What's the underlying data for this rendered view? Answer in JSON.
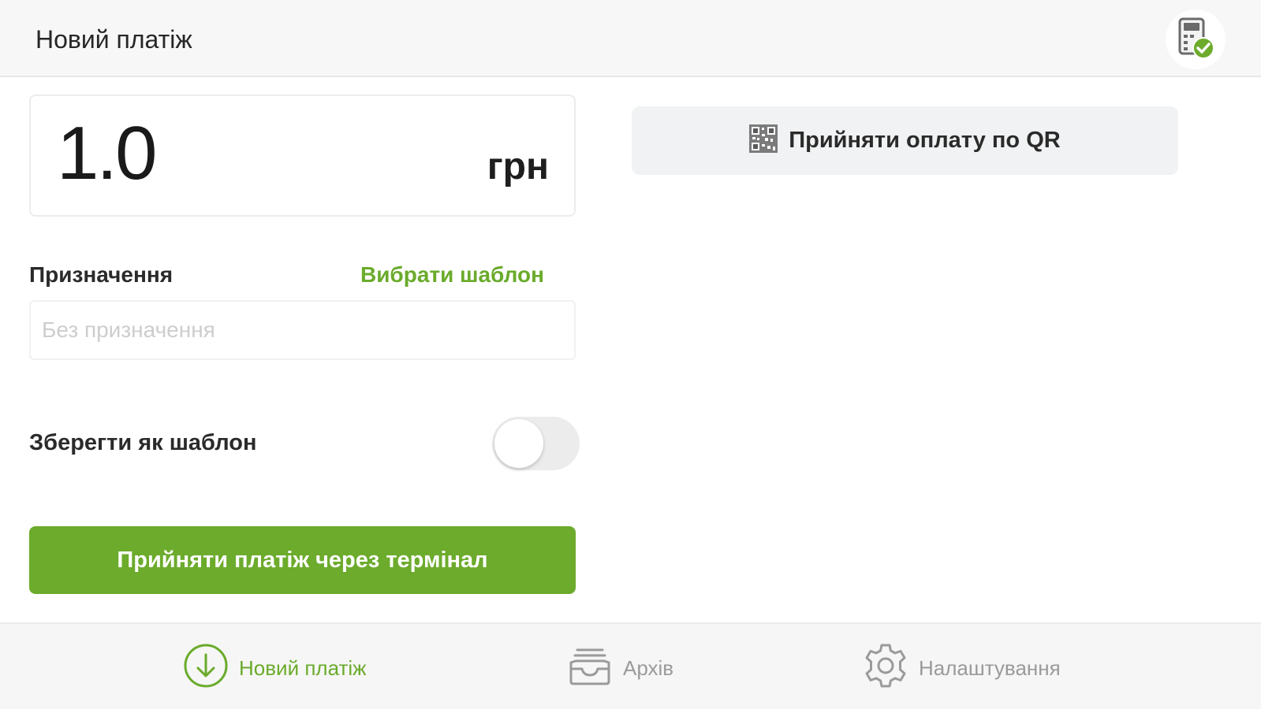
{
  "header": {
    "title": "Новий платіж",
    "terminal_icon": "terminal-connected-icon"
  },
  "amount": {
    "value": "1.0",
    "currency": "грн"
  },
  "qr_button": {
    "label": "Прийняти оплату по QR",
    "icon": "qr-code-icon"
  },
  "purpose": {
    "label": "Призначення",
    "template_link": "Вибрати шаблон",
    "placeholder": "Без призначення",
    "value": ""
  },
  "save_template": {
    "label": "Зберегти як шаблон",
    "enabled": false
  },
  "primary_button": {
    "label": "Прийняти платіж через термінал"
  },
  "bottom_nav": {
    "items": [
      {
        "label": "Новий платіж",
        "icon": "download-circle-icon",
        "active": true
      },
      {
        "label": "Архів",
        "icon": "archive-tray-icon",
        "active": false
      },
      {
        "label": "Налаштування",
        "icon": "gear-icon",
        "active": false
      }
    ]
  },
  "colors": {
    "accent": "#6cab2c",
    "header_bg": "#f7f7f7",
    "inactive": "#9a9a9a"
  }
}
